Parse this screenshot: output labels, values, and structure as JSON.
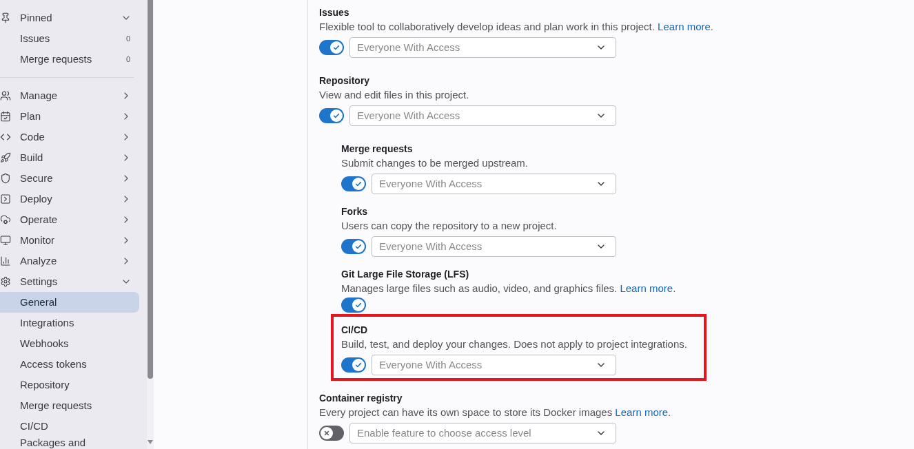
{
  "sidebar": {
    "pinned": {
      "label": "Pinned",
      "expanded": true,
      "items": [
        {
          "label": "Issues",
          "count": "0"
        },
        {
          "label": "Merge requests",
          "count": "0"
        }
      ]
    },
    "nav": [
      {
        "label": "Manage",
        "expanded": false
      },
      {
        "label": "Plan",
        "expanded": false
      },
      {
        "label": "Code",
        "expanded": false
      },
      {
        "label": "Build",
        "expanded": false
      },
      {
        "label": "Secure",
        "expanded": false
      },
      {
        "label": "Deploy",
        "expanded": false
      },
      {
        "label": "Operate",
        "expanded": false
      },
      {
        "label": "Monitor",
        "expanded": false
      },
      {
        "label": "Analyze",
        "expanded": false
      },
      {
        "label": "Settings",
        "expanded": true,
        "children": [
          {
            "label": "General",
            "selected": true
          },
          {
            "label": "Integrations",
            "selected": false
          },
          {
            "label": "Webhooks",
            "selected": false
          },
          {
            "label": "Access tokens",
            "selected": false
          },
          {
            "label": "Repository",
            "selected": false
          },
          {
            "label": "Merge requests",
            "selected": false
          },
          {
            "label": "CI/CD",
            "selected": false
          },
          {
            "label": "Packages and",
            "selected": false
          }
        ]
      }
    ]
  },
  "settings": {
    "sections": [
      {
        "title": "Issues",
        "description": "Flexible tool to collaboratively develop ideas and plan work in this project.",
        "link": {
          "text": "Learn more",
          "suffix": "."
        },
        "enabled": true,
        "access_level": {
          "value": "Everyone With Access"
        },
        "highlighted": false
      },
      {
        "title": "Repository",
        "description": "View and edit files in this project.",
        "enabled": true,
        "access_level": {
          "value": "Everyone With Access"
        },
        "highlighted": false,
        "children": [
          {
            "title": "Merge requests",
            "description": "Submit changes to be merged upstream.",
            "enabled": true,
            "access_level": {
              "value": "Everyone With Access"
            },
            "highlighted": false
          },
          {
            "title": "Forks",
            "description": "Users can copy the repository to a new project.",
            "enabled": true,
            "access_level": {
              "value": "Everyone With Access"
            },
            "highlighted": false
          },
          {
            "title": "Git Large File Storage (LFS)",
            "description": "Manages large files such as audio, video, and graphics files.",
            "link": {
              "text": "Learn more",
              "suffix": "."
            },
            "enabled": true,
            "highlighted": false
          },
          {
            "title": "CI/CD",
            "description": "Build, test, and deploy your changes. Does not apply to project integrations.",
            "enabled": true,
            "access_level": {
              "value": "Everyone With Access"
            },
            "highlighted": true
          }
        ]
      },
      {
        "title": "Container registry",
        "description": "Every project can have its own space to store its Docker images",
        "link": {
          "text": "Learn more",
          "suffix": "."
        },
        "enabled": false,
        "access_level": {
          "value": "Enable feature to choose access level"
        },
        "highlighted": false
      }
    ]
  }
}
